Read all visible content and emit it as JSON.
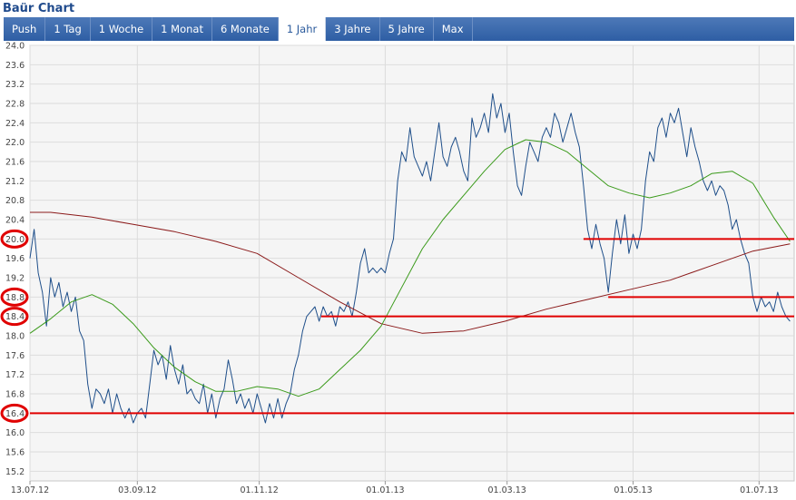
{
  "header": {
    "title": "Baür Chart"
  },
  "tabs": [
    {
      "label": "Push",
      "active": false
    },
    {
      "label": "1 Tag",
      "active": false
    },
    {
      "label": "1 Woche",
      "active": false
    },
    {
      "label": "1 Monat",
      "active": false
    },
    {
      "label": "6 Monate",
      "active": false
    },
    {
      "label": "1 Jahr",
      "active": true
    },
    {
      "label": "3 Jahre",
      "active": false
    },
    {
      "label": "5 Jahre",
      "active": false
    },
    {
      "label": "Max",
      "active": false
    }
  ],
  "chart_data": {
    "type": "line",
    "title": "",
    "xlabel": "",
    "ylabel": "",
    "ylim": [
      15.0,
      24.0
    ],
    "y_ticks": [
      "24.0",
      "23.6",
      "23.2",
      "22.8",
      "22.4",
      "22.0",
      "21.6",
      "21.2",
      "20.8",
      "20.4",
      "20.0",
      "19.6",
      "19.2",
      "18.8",
      "18.4",
      "18.0",
      "17.6",
      "17.2",
      "16.8",
      "16.4",
      "16.0",
      "15.6",
      "15.2"
    ],
    "x_ticks": [
      {
        "label": "13.07.12",
        "day": 0
      },
      {
        "label": "03.09.12",
        "day": 52
      },
      {
        "label": "01.11.12",
        "day": 111
      },
      {
        "label": "01.01.13",
        "day": 172
      },
      {
        "label": "01.03.13",
        "day": 231
      },
      {
        "label": "01.05.13",
        "day": 292
      },
      {
        "label": "01.07.13",
        "day": 353
      }
    ],
    "xlim_days": [
      0,
      370
    ],
    "grid": true,
    "series": [
      {
        "color": "#1f4f8a",
        "points": [
          [
            0,
            19.6
          ],
          [
            2,
            20.2
          ],
          [
            4,
            19.3
          ],
          [
            6,
            18.9
          ],
          [
            8,
            18.2
          ],
          [
            10,
            19.2
          ],
          [
            12,
            18.8
          ],
          [
            14,
            19.1
          ],
          [
            16,
            18.6
          ],
          [
            18,
            18.9
          ],
          [
            20,
            18.5
          ],
          [
            22,
            18.8
          ],
          [
            24,
            18.1
          ],
          [
            26,
            17.9
          ],
          [
            28,
            17.0
          ],
          [
            30,
            16.5
          ],
          [
            32,
            16.9
          ],
          [
            34,
            16.8
          ],
          [
            36,
            16.6
          ],
          [
            38,
            16.9
          ],
          [
            40,
            16.4
          ],
          [
            42,
            16.8
          ],
          [
            44,
            16.5
          ],
          [
            46,
            16.3
          ],
          [
            48,
            16.5
          ],
          [
            50,
            16.2
          ],
          [
            52,
            16.4
          ],
          [
            54,
            16.5
          ],
          [
            56,
            16.3
          ],
          [
            58,
            17.0
          ],
          [
            60,
            17.7
          ],
          [
            62,
            17.4
          ],
          [
            64,
            17.6
          ],
          [
            66,
            17.1
          ],
          [
            68,
            17.8
          ],
          [
            70,
            17.3
          ],
          [
            72,
            17.0
          ],
          [
            74,
            17.4
          ],
          [
            76,
            16.8
          ],
          [
            78,
            16.9
          ],
          [
            80,
            16.7
          ],
          [
            82,
            16.6
          ],
          [
            84,
            17.0
          ],
          [
            86,
            16.4
          ],
          [
            88,
            16.8
          ],
          [
            90,
            16.3
          ],
          [
            92,
            16.7
          ],
          [
            94,
            16.9
          ],
          [
            96,
            17.5
          ],
          [
            98,
            17.1
          ],
          [
            100,
            16.6
          ],
          [
            102,
            16.8
          ],
          [
            104,
            16.5
          ],
          [
            106,
            16.7
          ],
          [
            108,
            16.4
          ],
          [
            110,
            16.8
          ],
          [
            112,
            16.5
          ],
          [
            114,
            16.2
          ],
          [
            116,
            16.6
          ],
          [
            118,
            16.3
          ],
          [
            120,
            16.7
          ],
          [
            122,
            16.3
          ],
          [
            124,
            16.6
          ],
          [
            126,
            16.8
          ],
          [
            128,
            17.3
          ],
          [
            130,
            17.6
          ],
          [
            132,
            18.1
          ],
          [
            134,
            18.4
          ],
          [
            136,
            18.5
          ],
          [
            138,
            18.6
          ],
          [
            140,
            18.3
          ],
          [
            142,
            18.6
          ],
          [
            144,
            18.4
          ],
          [
            146,
            18.5
          ],
          [
            148,
            18.2
          ],
          [
            150,
            18.6
          ],
          [
            152,
            18.5
          ],
          [
            154,
            18.7
          ],
          [
            156,
            18.4
          ],
          [
            158,
            18.9
          ],
          [
            160,
            19.5
          ],
          [
            162,
            19.8
          ],
          [
            164,
            19.3
          ],
          [
            166,
            19.4
          ],
          [
            168,
            19.3
          ],
          [
            170,
            19.4
          ],
          [
            172,
            19.3
          ],
          [
            174,
            19.7
          ],
          [
            176,
            20.0
          ],
          [
            178,
            21.2
          ],
          [
            180,
            21.8
          ],
          [
            182,
            21.6
          ],
          [
            184,
            22.3
          ],
          [
            186,
            21.7
          ],
          [
            188,
            21.5
          ],
          [
            190,
            21.3
          ],
          [
            192,
            21.6
          ],
          [
            194,
            21.2
          ],
          [
            196,
            21.8
          ],
          [
            198,
            22.4
          ],
          [
            200,
            21.7
          ],
          [
            202,
            21.5
          ],
          [
            204,
            21.9
          ],
          [
            206,
            22.1
          ],
          [
            208,
            21.8
          ],
          [
            210,
            21.4
          ],
          [
            212,
            21.2
          ],
          [
            214,
            22.5
          ],
          [
            216,
            22.1
          ],
          [
            218,
            22.3
          ],
          [
            220,
            22.6
          ],
          [
            222,
            22.2
          ],
          [
            224,
            23.0
          ],
          [
            226,
            22.5
          ],
          [
            228,
            22.8
          ],
          [
            230,
            22.2
          ],
          [
            232,
            22.6
          ],
          [
            234,
            21.8
          ],
          [
            236,
            21.1
          ],
          [
            238,
            20.9
          ],
          [
            240,
            21.5
          ],
          [
            242,
            22.0
          ],
          [
            244,
            21.8
          ],
          [
            246,
            21.6
          ],
          [
            248,
            22.1
          ],
          [
            250,
            22.3
          ],
          [
            252,
            22.1
          ],
          [
            254,
            22.6
          ],
          [
            256,
            22.4
          ],
          [
            258,
            22.0
          ],
          [
            260,
            22.3
          ],
          [
            262,
            22.6
          ],
          [
            264,
            22.2
          ],
          [
            266,
            21.9
          ],
          [
            268,
            21.1
          ],
          [
            270,
            20.2
          ],
          [
            272,
            19.8
          ],
          [
            274,
            20.3
          ],
          [
            276,
            19.9
          ],
          [
            278,
            19.6
          ],
          [
            280,
            18.9
          ],
          [
            282,
            19.7
          ],
          [
            284,
            20.4
          ],
          [
            286,
            19.9
          ],
          [
            288,
            20.5
          ],
          [
            290,
            19.7
          ],
          [
            292,
            20.1
          ],
          [
            294,
            19.8
          ],
          [
            296,
            20.2
          ],
          [
            298,
            21.2
          ],
          [
            300,
            21.8
          ],
          [
            302,
            21.6
          ],
          [
            304,
            22.3
          ],
          [
            306,
            22.5
          ],
          [
            308,
            22.1
          ],
          [
            310,
            22.6
          ],
          [
            312,
            22.4
          ],
          [
            314,
            22.7
          ],
          [
            316,
            22.2
          ],
          [
            318,
            21.7
          ],
          [
            320,
            22.3
          ],
          [
            322,
            21.9
          ],
          [
            324,
            21.6
          ],
          [
            326,
            21.2
          ],
          [
            328,
            21.0
          ],
          [
            330,
            21.2
          ],
          [
            332,
            20.9
          ],
          [
            334,
            21.1
          ],
          [
            336,
            21.0
          ],
          [
            338,
            20.7
          ],
          [
            340,
            20.2
          ],
          [
            342,
            20.4
          ],
          [
            344,
            20.0
          ],
          [
            346,
            19.7
          ],
          [
            348,
            19.5
          ],
          [
            350,
            18.8
          ],
          [
            352,
            18.5
          ],
          [
            354,
            18.8
          ],
          [
            356,
            18.6
          ],
          [
            358,
            18.7
          ],
          [
            360,
            18.5
          ],
          [
            362,
            18.9
          ],
          [
            364,
            18.6
          ],
          [
            366,
            18.4
          ],
          [
            368,
            18.3
          ]
        ]
      },
      {
        "color": "#8b1a1a",
        "points": [
          [
            0,
            20.55
          ],
          [
            10,
            20.55
          ],
          [
            30,
            20.45
          ],
          [
            50,
            20.3
          ],
          [
            70,
            20.15
          ],
          [
            90,
            19.95
          ],
          [
            110,
            19.7
          ],
          [
            130,
            19.2
          ],
          [
            150,
            18.7
          ],
          [
            170,
            18.25
          ],
          [
            190,
            18.05
          ],
          [
            210,
            18.1
          ],
          [
            230,
            18.3
          ],
          [
            250,
            18.55
          ],
          [
            270,
            18.75
          ],
          [
            290,
            18.95
          ],
          [
            310,
            19.15
          ],
          [
            330,
            19.45
          ],
          [
            350,
            19.75
          ],
          [
            368,
            19.9
          ]
        ]
      },
      {
        "color": "#3a9a1a",
        "points": [
          [
            0,
            18.05
          ],
          [
            10,
            18.35
          ],
          [
            20,
            18.7
          ],
          [
            30,
            18.85
          ],
          [
            40,
            18.65
          ],
          [
            50,
            18.25
          ],
          [
            60,
            17.75
          ],
          [
            70,
            17.35
          ],
          [
            80,
            17.05
          ],
          [
            90,
            16.85
          ],
          [
            100,
            16.85
          ],
          [
            110,
            16.95
          ],
          [
            120,
            16.9
          ],
          [
            130,
            16.75
          ],
          [
            140,
            16.9
          ],
          [
            150,
            17.3
          ],
          [
            160,
            17.7
          ],
          [
            170,
            18.2
          ],
          [
            180,
            19.0
          ],
          [
            190,
            19.8
          ],
          [
            200,
            20.4
          ],
          [
            210,
            20.9
          ],
          [
            220,
            21.4
          ],
          [
            230,
            21.85
          ],
          [
            240,
            22.05
          ],
          [
            250,
            22.0
          ],
          [
            260,
            21.8
          ],
          [
            270,
            21.45
          ],
          [
            280,
            21.1
          ],
          [
            290,
            20.95
          ],
          [
            300,
            20.85
          ],
          [
            310,
            20.95
          ],
          [
            320,
            21.1
          ],
          [
            330,
            21.35
          ],
          [
            340,
            21.4
          ],
          [
            350,
            21.15
          ],
          [
            360,
            20.45
          ],
          [
            368,
            19.95
          ]
        ]
      }
    ],
    "support_lines": [
      {
        "value": 20.0,
        "from_day": 268,
        "to_day": 370
      },
      {
        "value": 18.8,
        "from_day": 280,
        "to_day": 370
      },
      {
        "value": 18.4,
        "from_day": 141,
        "to_day": 370
      },
      {
        "value": 16.4,
        "from_day": 0,
        "to_day": 370
      }
    ],
    "highlighted_ticks": [
      "20.0",
      "18.8",
      "18.4",
      "16.4"
    ]
  }
}
